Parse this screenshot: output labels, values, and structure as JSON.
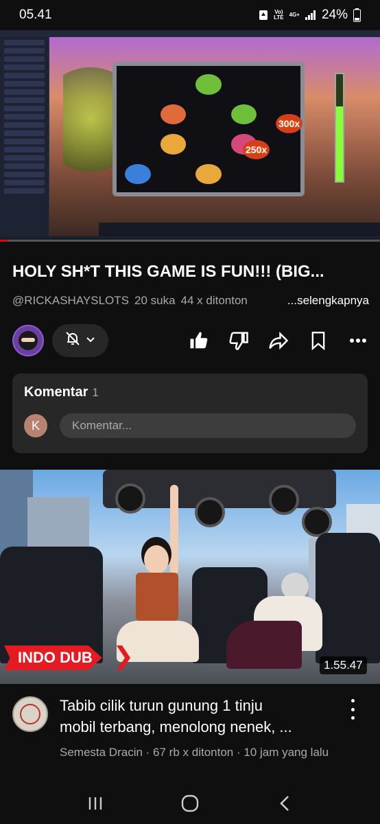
{
  "status_bar": {
    "time": "05.41",
    "network_label_top": "Vo)",
    "network_label_bottom": "LTE",
    "data_label": "4G+",
    "battery": "24%"
  },
  "player": {
    "game_symbol_colors": [
      "#e06b3a",
      "#d5487a",
      "#6fbf3a",
      "#3a7fd9",
      "#b84a9a",
      "#e8a83a"
    ],
    "win_badge_1": "300x",
    "win_badge_2": "250x",
    "progress_fraction": 0.02
  },
  "video": {
    "title": "HOLY SH*T THIS GAME IS FUN!!! (BIG...",
    "channel": "@RICKASHAYSLOTS",
    "likes": "20 suka",
    "views": "44 x ditonton",
    "more": "...selengkapnya"
  },
  "actions": {
    "bell_icon": "bell-off-icon",
    "like_icon": "thumbs-up-icon",
    "dislike_icon": "thumbs-down-icon",
    "share_icon": "share-icon",
    "save_icon": "bookmark-icon",
    "more_icon": "more-icon"
  },
  "comments": {
    "heading": "Komentar",
    "count": "1",
    "avatar_letter": "K",
    "placeholder": "Komentar..."
  },
  "next_video": {
    "badge": "INDO DUB",
    "duration": "1.55.47",
    "title_line1": "Tabib cilik turun gunung 1 tinju",
    "title_line2": "mobil terbang, menolong nenek, ...",
    "meta": "Semesta Dracin · 67 rb x ditonton · 10 jam yang lalu"
  },
  "colors": {
    "background": "#0f0f0f",
    "card": "#272727",
    "accent_red": "#e31b23",
    "text_secondary": "#aaaaaa"
  }
}
